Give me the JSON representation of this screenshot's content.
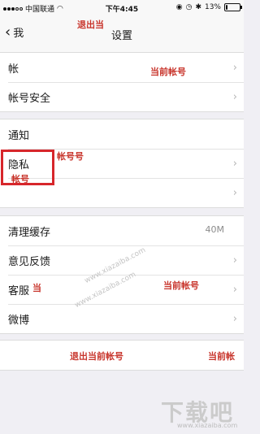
{
  "status_bar": {
    "carrier": "中国联通",
    "wifi_icon": "wifi-icon",
    "time": "下午4:45",
    "battery": "13%",
    "battery_level": 0.13
  },
  "nav": {
    "back_label": "我",
    "title": "设置"
  },
  "groups": [
    {
      "rows": [
        {
          "label": "帐",
          "chevron": true
        },
        {
          "label": "帐号安全",
          "chevron": true
        }
      ]
    },
    {
      "rows": [
        {
          "label": "通知",
          "chevron": false
        },
        {
          "label": "隐私",
          "chevron": true
        },
        {
          "label": "",
          "chevron": true
        }
      ]
    },
    {
      "rows": [
        {
          "label": "清理缓存",
          "value": "40M",
          "chevron": false
        },
        {
          "label": "意见反馈",
          "chevron": true
        },
        {
          "label": "客服",
          "chevron": true
        },
        {
          "label": "微博",
          "chevron": true
        }
      ]
    }
  ],
  "logout": {
    "label": "退出当前帐号"
  },
  "watermarks": {
    "a": "退出当",
    "b": "当前帐号",
    "c": "帐号号",
    "d": "帐号",
    "e": "当前帐号",
    "f": "退出当前帐号",
    "g": "当前帐",
    "h": "当",
    "i": "www.xiazaiba.com"
  },
  "logo": {
    "text": "下载吧",
    "url": "www.xiazaiba.com"
  }
}
